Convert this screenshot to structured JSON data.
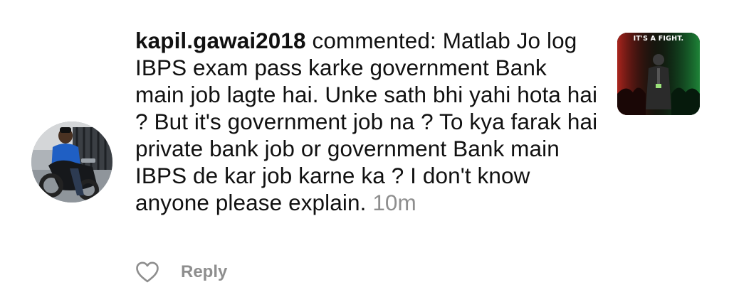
{
  "comment": {
    "username": "kapil.gawai2018",
    "action": " commented: ",
    "text": "Matlab Jo log IBPS exam pass karke government Bank main job lagte hai. Unke sath bhi yahi hota hai ? But it's government job na ? To kya farak hai private bank job or government Bank main IBPS de kar job karne ka ? I don't know anyone please explain.",
    "time": "10m"
  },
  "post": {
    "thumbnail_caption": "IT'S A FIGHT."
  },
  "actions": {
    "like_icon": "heart-outline-icon",
    "reply_label": "Reply"
  },
  "colors": {
    "text": "#111111",
    "muted": "#8e8e8e",
    "background": "#ffffff"
  }
}
